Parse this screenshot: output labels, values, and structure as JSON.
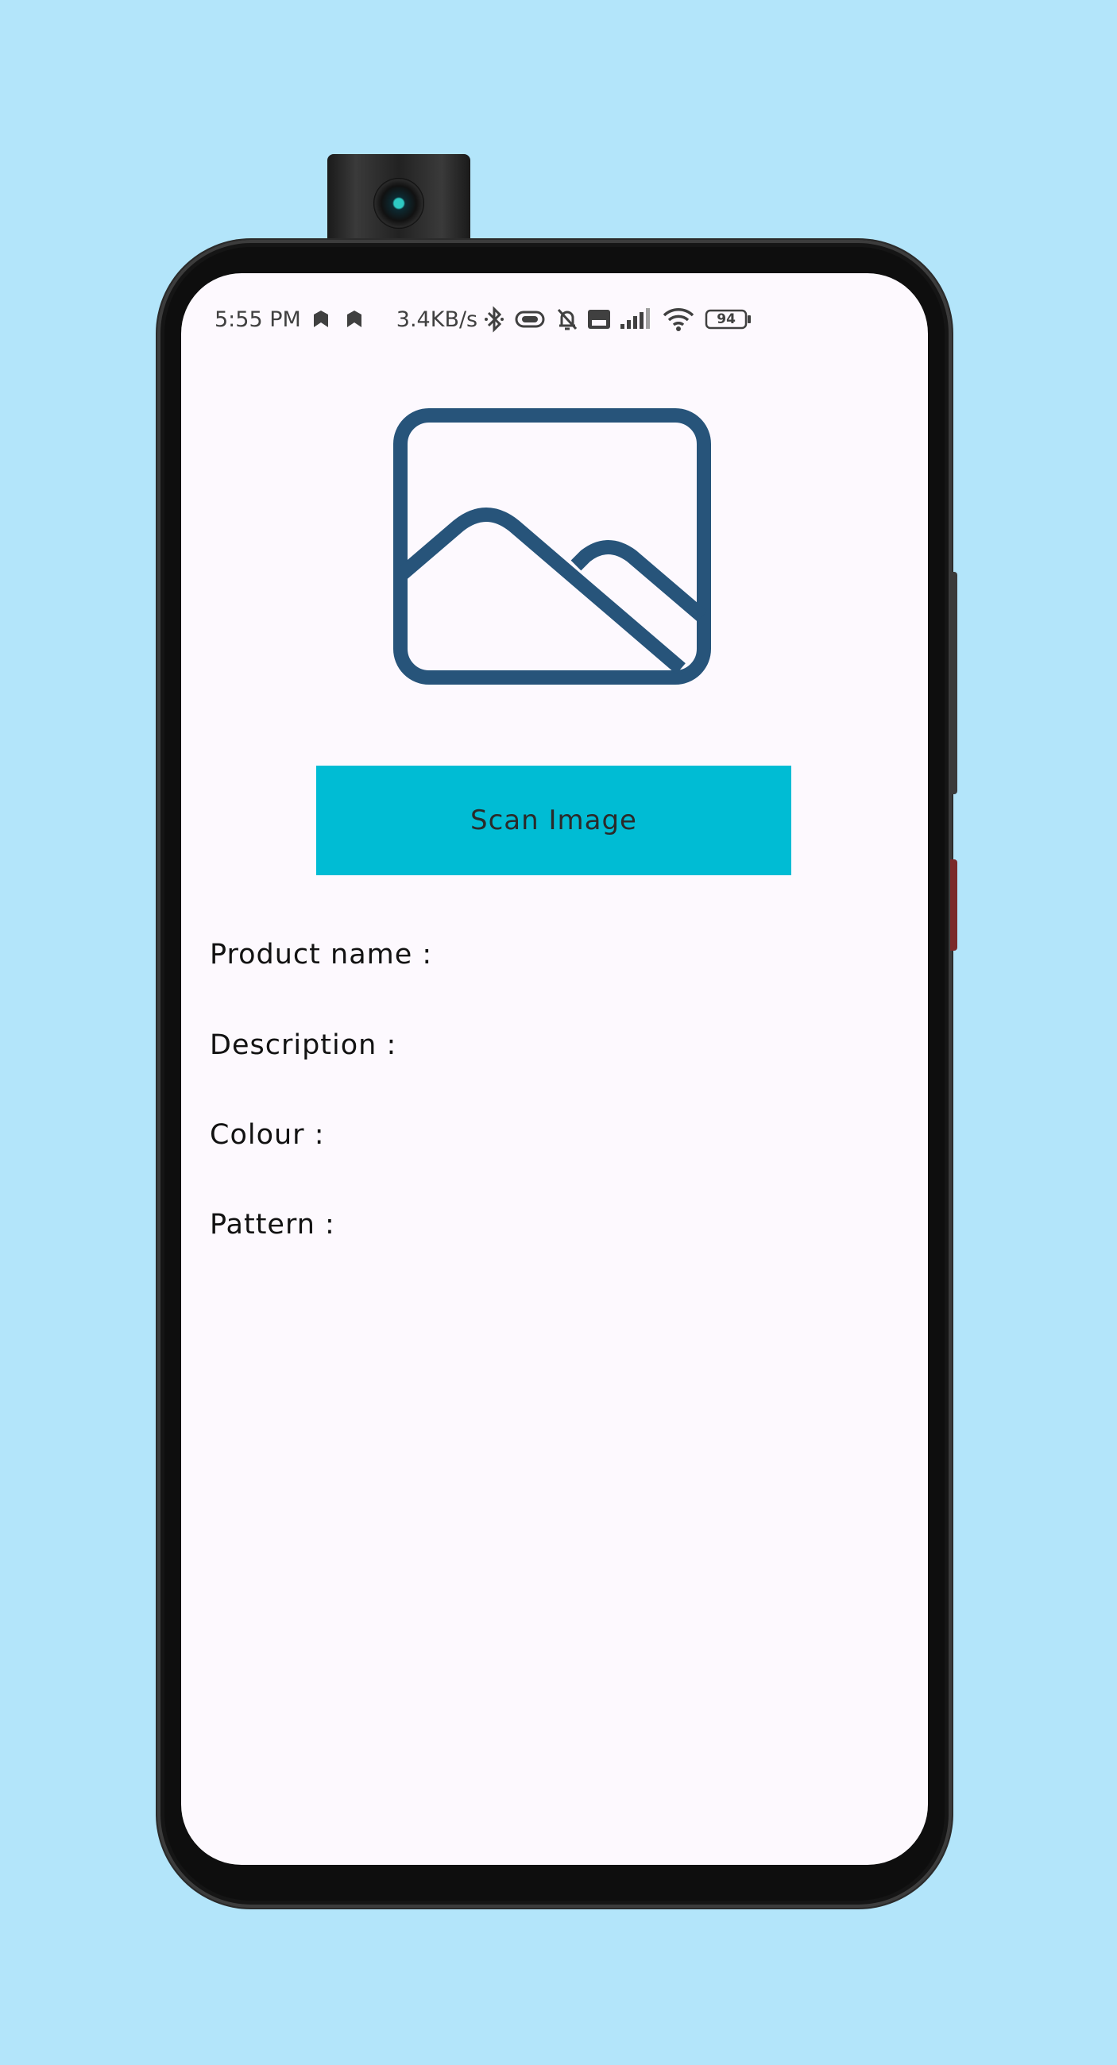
{
  "status_bar": {
    "time": "5:55 PM",
    "net_speed": "3.4KB/s",
    "battery": "94",
    "icons": [
      "notification-icon",
      "notification-icon",
      "bluetooth-icon",
      "vibrate-icon",
      "mute-icon",
      "volte-icon",
      "signal-icon",
      "wifi-icon",
      "battery-icon"
    ]
  },
  "hero": {
    "icon": "image-placeholder-icon",
    "color": "#27547a"
  },
  "scan_button": {
    "label": "Scan Image",
    "color": "#00bcd4"
  },
  "fields": [
    {
      "label": "Product name :"
    },
    {
      "label": "Description :"
    },
    {
      "label": "Colour :"
    },
    {
      "label": "Pattern :"
    }
  ]
}
